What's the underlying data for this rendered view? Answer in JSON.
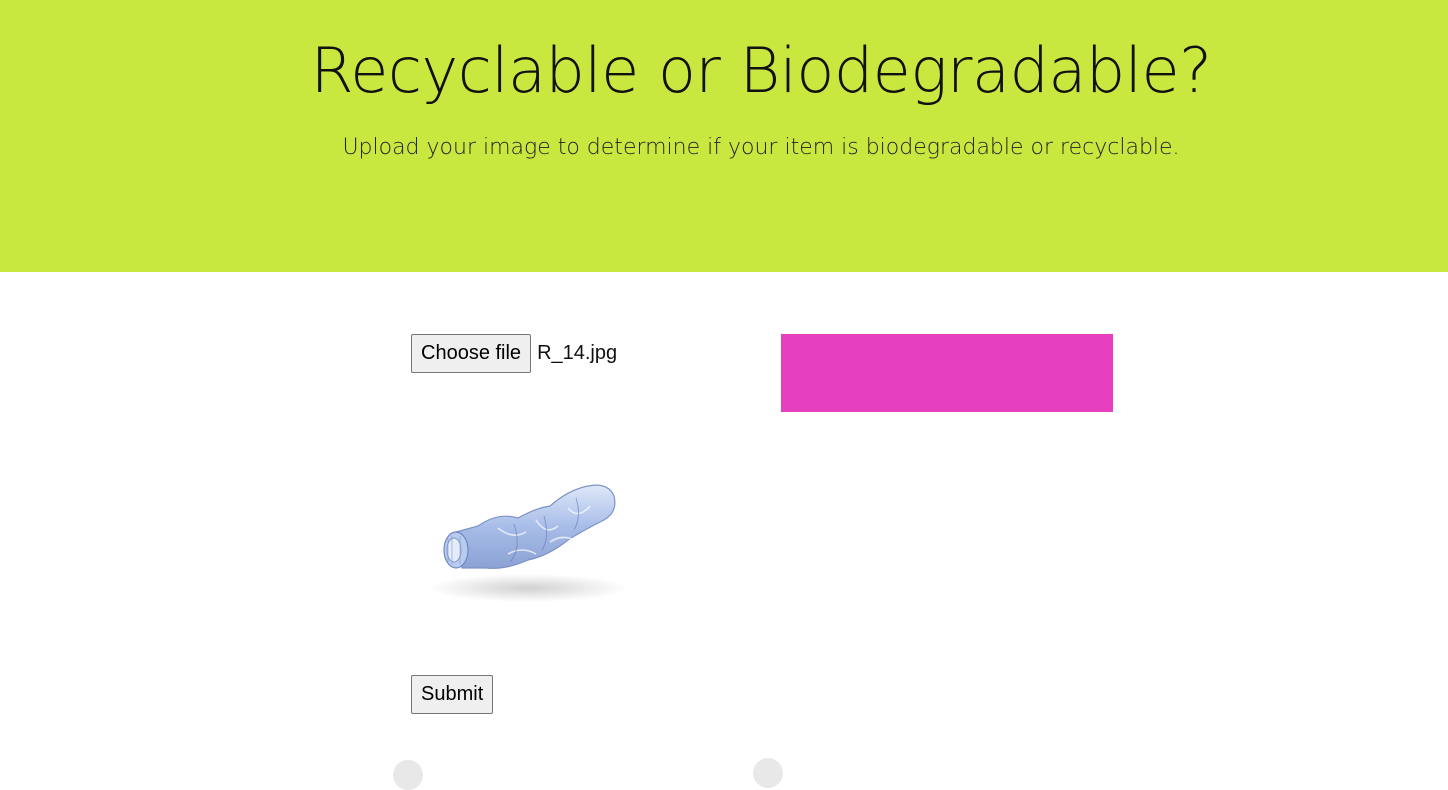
{
  "hero": {
    "title": "Recyclable or Biodegradable?",
    "subtitle": "Upload your image to determine if your item is biodegradable or recyclable.",
    "background_color": "#c8e840"
  },
  "upload": {
    "choose_file_label": "Choose file",
    "file_name": "R_14.jpg",
    "submit_label": "Submit"
  },
  "result": {
    "color": "#e63fbf"
  },
  "preview": {
    "subject": "crumpled plastic bottle"
  }
}
